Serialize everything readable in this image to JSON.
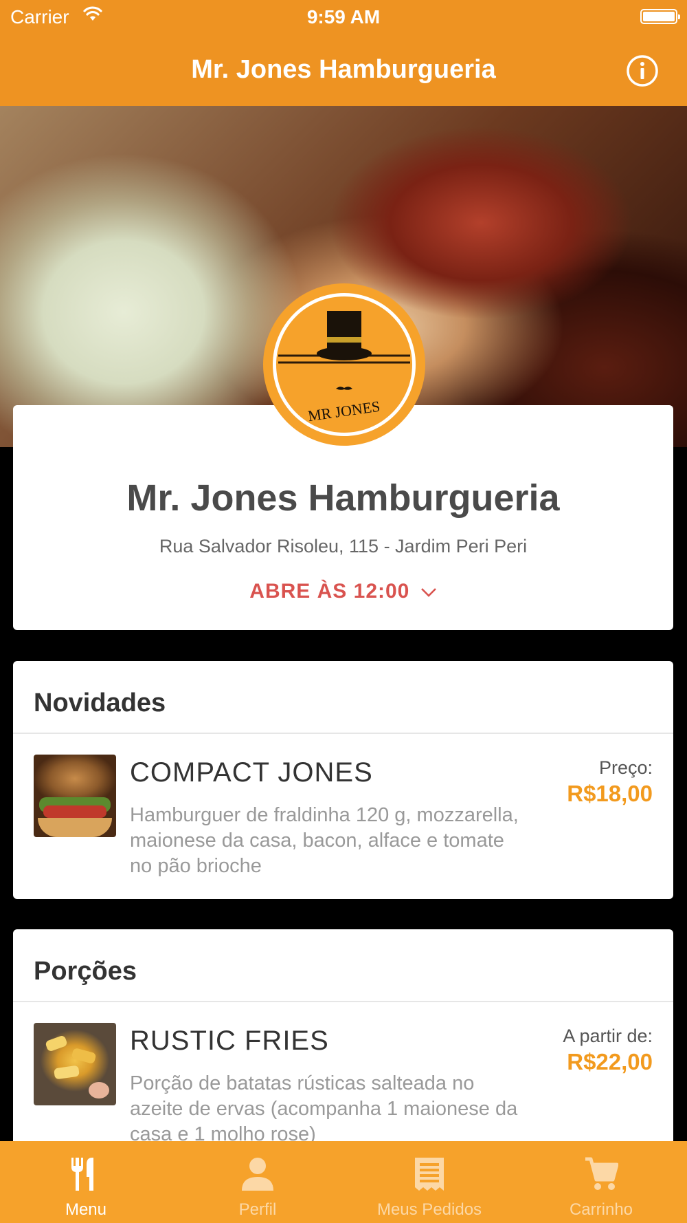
{
  "status_bar": {
    "carrier": "Carrier",
    "time": "9:59 AM"
  },
  "nav": {
    "title": "Mr. Jones Hamburgueria",
    "info_icon": "info-circle-icon"
  },
  "logo": {
    "text": "MR JONES"
  },
  "restaurant": {
    "name": "Mr. Jones Hamburgueria",
    "address": "Rua Salvador Risoleu, 115 - Jardim Peri Peri",
    "hours": "ABRE ÀS 12:00"
  },
  "sections": [
    {
      "title": "Novidades",
      "item": {
        "name": "COMPACT JONES",
        "description": "Hamburguer de fraldinha 120 g, mozzarella, maionese da casa, bacon, alface e tomate no pão brioche",
        "price_label": "Preço:",
        "price": "R$18,00"
      }
    },
    {
      "title": "Porções",
      "item": {
        "name": "RUSTIC FRIES",
        "description": "Porção de batatas rústicas salteada no azeite de ervas (acompanha 1 maionese da casa e 1 molho rose)",
        "price_label": "A partir de:",
        "price": "R$22,00"
      }
    }
  ],
  "tabs": [
    {
      "label": "Menu",
      "icon": "fork-knife-icon",
      "active": true
    },
    {
      "label": "Perfil",
      "icon": "person-icon",
      "active": false
    },
    {
      "label": "Meus Pedidos",
      "icon": "receipt-icon",
      "active": false
    },
    {
      "label": "Carrinho",
      "icon": "cart-icon",
      "active": false
    }
  ],
  "colors": {
    "brand_orange": "#EE9322",
    "tab_orange": "#F6A22B",
    "price_orange": "#F29A1E",
    "hours_red": "#D9534F"
  }
}
